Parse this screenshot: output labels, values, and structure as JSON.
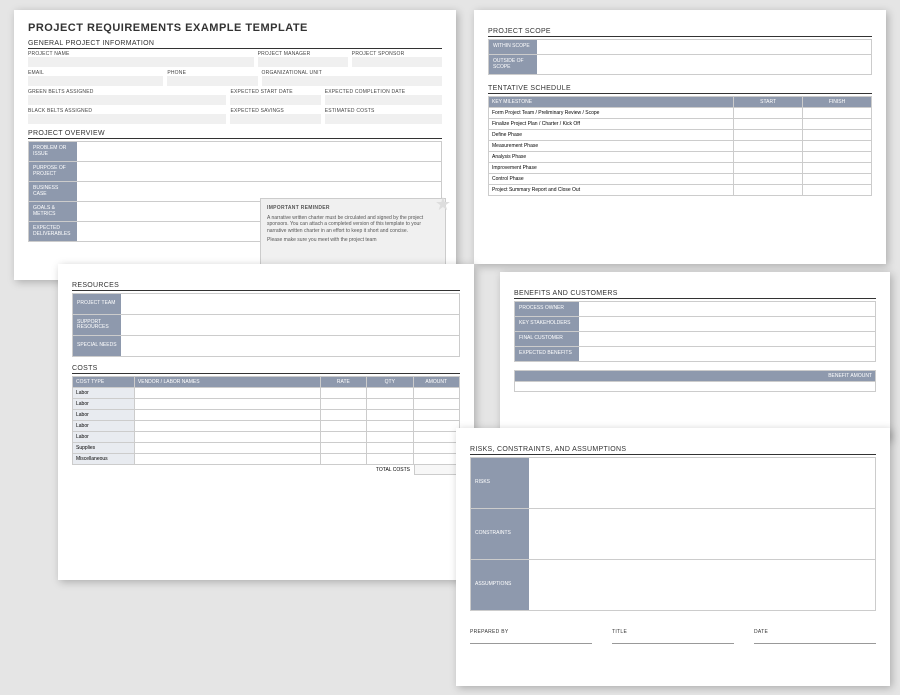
{
  "document_title": "PROJECT REQUIREMENTS EXAMPLE TEMPLATE",
  "sections": {
    "general_info": {
      "heading": "GENERAL PROJECT INFORMATION",
      "fields": {
        "project_name": "PROJECT NAME",
        "project_manager": "PROJECT MANAGER",
        "project_sponsor": "PROJECT SPONSOR",
        "email": "EMAIL",
        "phone": "PHONE",
        "org_unit": "ORGANIZATIONAL UNIT",
        "green_belts": "GREEN BELTS ASSIGNED",
        "expected_start": "EXPECTED START DATE",
        "expected_completion": "EXPECTED COMPLETION DATE",
        "black_belts": "BLACK BELTS ASSIGNED",
        "expected_savings": "EXPECTED SAVINGS",
        "estimated_costs": "ESTIMATED COSTS"
      }
    },
    "overview": {
      "heading": "PROJECT OVERVIEW",
      "rows": [
        "PROBLEM OR ISSUE",
        "PURPOSE OF PROJECT",
        "BUSINESS CASE",
        "GOALS & METRICS",
        "EXPECTED DELIVERABLES"
      ],
      "reminder": {
        "title": "IMPORTANT REMINDER",
        "body1": "A narrative written charter must be circulated and signed by the project sponsors. You can attach a completed version of this template to your narrative written charter in an effort to keep it short and concise.",
        "body2": "Please make sure you meet with the project team"
      }
    },
    "scope": {
      "heading": "PROJECT SCOPE",
      "rows": [
        "WITHIN SCOPE",
        "OUTSIDE OF SCOPE"
      ]
    },
    "schedule": {
      "heading": "TENTATIVE SCHEDULE",
      "columns": [
        "KEY MILESTONE",
        "START",
        "FINISH"
      ],
      "rows": [
        "Form Project Team / Preliminary Review / Scope",
        "Finalize Project Plan / Charter / Kick Off",
        "Define Phase",
        "Measurement Phase",
        "Analysis Phase",
        "Improvement Phase",
        "Control Phase",
        "Project Summary Report and Close Out"
      ]
    },
    "resources": {
      "heading": "RESOURCES",
      "rows": [
        "PROJECT TEAM",
        "SUPPORT RESOURCES",
        "SPECIAL NEEDS"
      ]
    },
    "costs": {
      "heading": "COSTS",
      "columns": [
        "COST TYPE",
        "VENDOR / LABOR NAMES",
        "RATE",
        "QTY",
        "AMOUNT"
      ],
      "rows": [
        "Labor",
        "Labor",
        "Labor",
        "Labor",
        "Labor",
        "Supplies",
        "Miscellaneous"
      ],
      "total_label": "TOTAL COSTS"
    },
    "benefits": {
      "heading": "BENEFITS AND CUSTOMERS",
      "rows": [
        "PROCESS OWNER",
        "KEY STAKEHOLDERS",
        "FINAL CUSTOMER",
        "EXPECTED BENEFITS"
      ],
      "benefit_amount_col": "BENEFIT AMOUNT"
    },
    "risks": {
      "heading": "RISKS, CONSTRAINTS, AND ASSUMPTIONS",
      "rows": [
        "RISKS",
        "CONSTRAINTS",
        "ASSUMPTIONS"
      ]
    },
    "signoff": {
      "prepared_by": "PREPARED BY",
      "title": "TITLE",
      "date": "DATE"
    }
  }
}
